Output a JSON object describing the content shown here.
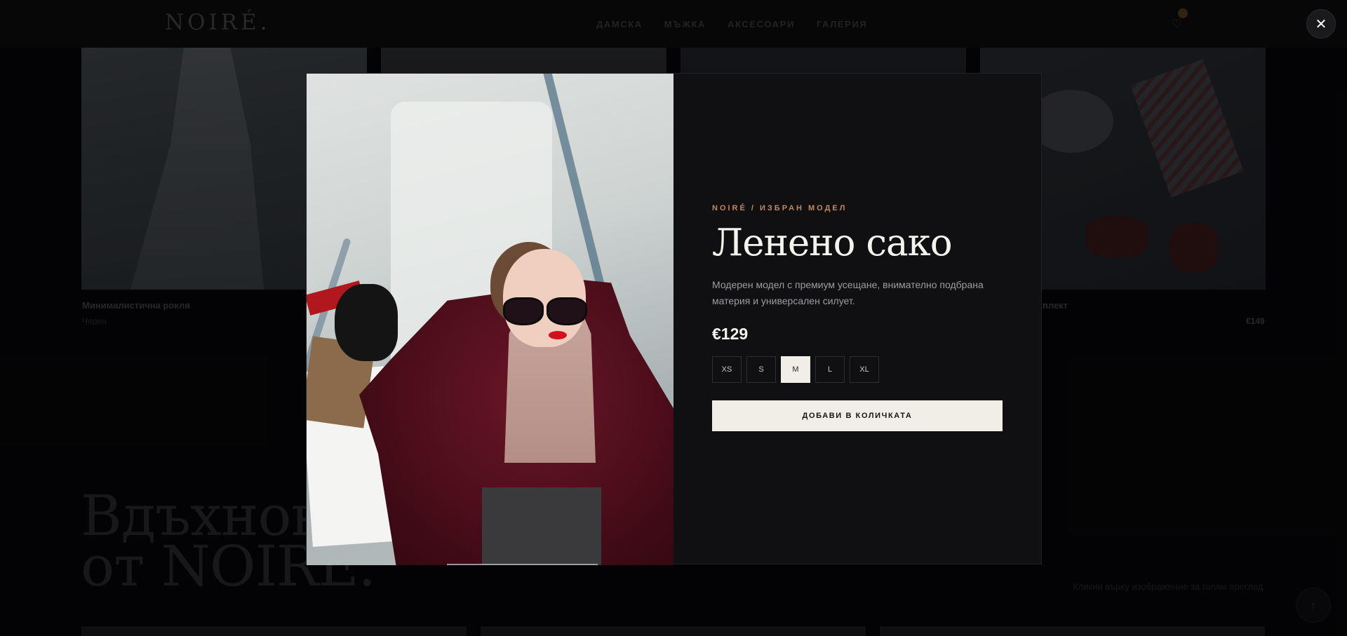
{
  "header": {
    "logo": "NOIRÉ",
    "logo_dot": ".",
    "nav": [
      "ДАМСКА",
      "МЪЖКА",
      "АКСЕСОАРИ",
      "ГАЛЕРИЯ"
    ],
    "wishlist_icon": "heart-icon"
  },
  "products": [
    {
      "title": "Минималистична рокля",
      "subtitle": "Черен",
      "price": ""
    },
    {
      "title": "плект",
      "subtitle": "",
      "price": "€149"
    }
  ],
  "hero": {
    "line1": "Вдъхнове",
    "line2": "от NOIRE.",
    "hint": "Кликни върху изображение за голям преглед."
  },
  "modal": {
    "eyebrow": "NOIRÉ / ИЗБРАН МОДЕЛ",
    "title": "Ленено сако",
    "description": "Модерен модел с премиум усещане, внимателно подбрана материя и универсален силует.",
    "price": "€129",
    "sizes": [
      "XS",
      "S",
      "M",
      "L",
      "XL"
    ],
    "selected_size": "M",
    "add_to_cart": "ДОБАВИ В КОЛИЧКАТА",
    "close_icon": "close-icon",
    "image_alt": "Жена в бордо палто със слънчеви очила и пазарски торби"
  },
  "colors": {
    "accent": "#c4875a",
    "modal_bg": "#101013",
    "button_bg": "#f1eee7"
  }
}
